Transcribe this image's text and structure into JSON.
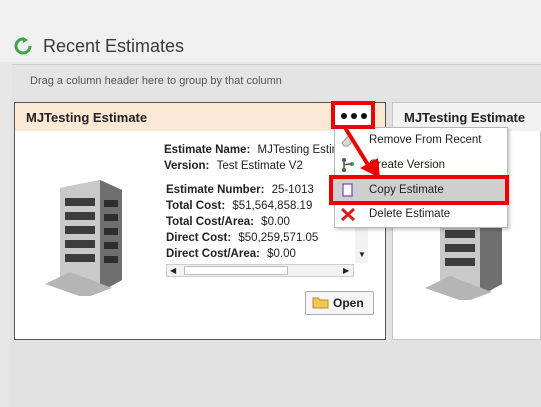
{
  "header": {
    "title": "Recent Estimates"
  },
  "group_panel": {
    "hint": "Drag a column header here to group by that column"
  },
  "cards": [
    {
      "title": "MJTesting Estimate",
      "estimate_name_label": "Estimate Name:",
      "estimate_name_value": "MJTesting Estimate",
      "version_label": "Version:",
      "version_value": "Test Estimate V2",
      "estimate_number_label": "Estimate Number:",
      "estimate_number_value": "25-1013",
      "total_cost_label": "Total Cost:",
      "total_cost_value": "$51,564,858.19",
      "total_cost_area_label": "Total Cost/Area:",
      "total_cost_area_value": "$0.00",
      "direct_cost_label": "Direct Cost:",
      "direct_cost_value": "$50,259,571.05",
      "direct_cost_area_label": "Direct Cost/Area:",
      "direct_cost_area_value": "$0.00",
      "open_label": "Open"
    },
    {
      "title": "MJTesting Estimate"
    }
  ],
  "context_menu": {
    "items": [
      {
        "label": "Remove From Recent",
        "icon": "eraser-icon"
      },
      {
        "label": "Create Version",
        "icon": "branch-icon"
      },
      {
        "label": "Copy Estimate",
        "icon": "copy-icon"
      },
      {
        "label": "Delete Estimate",
        "icon": "delete-icon"
      }
    ]
  },
  "colors": {
    "highlight": "#e00000",
    "card_header": "#fbe9d5",
    "accent_green": "#3aa648"
  }
}
